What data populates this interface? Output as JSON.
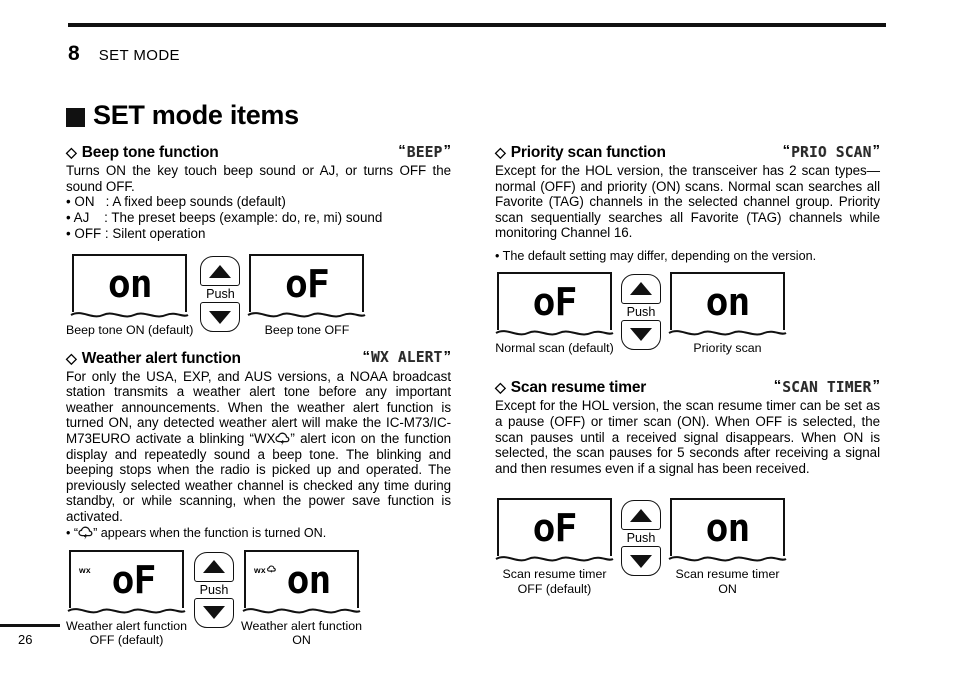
{
  "header": {
    "chapter_number": "8",
    "chapter_title": "SET MODE"
  },
  "main_title": "SET mode items",
  "footer": {
    "page_number": "26"
  },
  "common": {
    "diamond": "◇",
    "quote_open": "“",
    "quote_close": "”",
    "push_label": "Push",
    "wx_indicator": "wx"
  },
  "sections": {
    "beep": {
      "title": "Beep tone function",
      "lcd_label": "BEEP",
      "body": "Turns ON the key touch beep sound or AJ, or turns OFF the sound OFF.",
      "bullets": [
        "• ON   : A fixed beep sounds (default)",
        "• AJ    : The preset beeps (example: do, re, mi) sound",
        "• OFF : Silent operation"
      ],
      "figures": {
        "left": {
          "digits": "on",
          "caption": "Beep tone ON (default)"
        },
        "right": {
          "digits": "oF",
          "caption": "Beep tone OFF"
        }
      }
    },
    "weather_alert": {
      "title": "Weather alert function",
      "lcd_label": "WX ALERT",
      "body_part1": "For only the USA, EXP, and AUS versions, a NOAA broadcast station transmits a weather alert tone before any important weather announcements. When the weather alert function is turned ON, any detected weather alert will make the IC-M73/IC-M73EURO activate a blinking “WX",
      "body_part2": "” alert icon on the function display and repeatedly sound a beep tone. The blinking and beeping stops when the radio is picked up and operated. The previously selected weather channel is checked any time during standby, or while scanning, when the power save function is activated.",
      "note_prefix": "• “",
      "note_suffix": "” appears when the function is turned ON.",
      "figures": {
        "left": {
          "digits": "oF",
          "indicator": "wx",
          "caption": "Weather alert function\nOFF (default)"
        },
        "right": {
          "digits": "on",
          "indicator": "wx",
          "caption": "Weather alert function\nON"
        }
      }
    },
    "priority_scan": {
      "title": "Priority scan function",
      "lcd_label": "PRIO SCAN",
      "body": "Except for the HOL version, the transceiver has 2 scan types— normal (OFF) and priority (ON) scans. Normal scan searches all Favorite (TAG) channels in the selected channel group. Priority scan sequentially searches all Favorite (TAG) channels while monitoring Channel 16.",
      "note": "• The default setting may differ, depending on the version.",
      "figures": {
        "left": {
          "digits": "oF",
          "caption": "Normal scan (default)"
        },
        "right": {
          "digits": "on",
          "caption": "Priority scan"
        }
      }
    },
    "scan_resume_timer": {
      "title": "Scan resume timer",
      "lcd_label": "SCAN TIMER",
      "body": "Except for the HOL version, the scan resume timer can be set as a pause (OFF) or timer scan (ON). When OFF is selected, the scan pauses until a received signal disappears. When ON is selected, the scan pauses for 5 seconds after receiving a signal and then resumes even if a signal has been received.",
      "figures": {
        "left": {
          "digits": "oF",
          "caption": "Scan resume timer\nOFF (default)"
        },
        "right": {
          "digits": "on",
          "caption": "Scan resume timer\nON"
        }
      }
    }
  },
  "colors": {
    "ink": "#111111",
    "page": "#ffffff"
  }
}
